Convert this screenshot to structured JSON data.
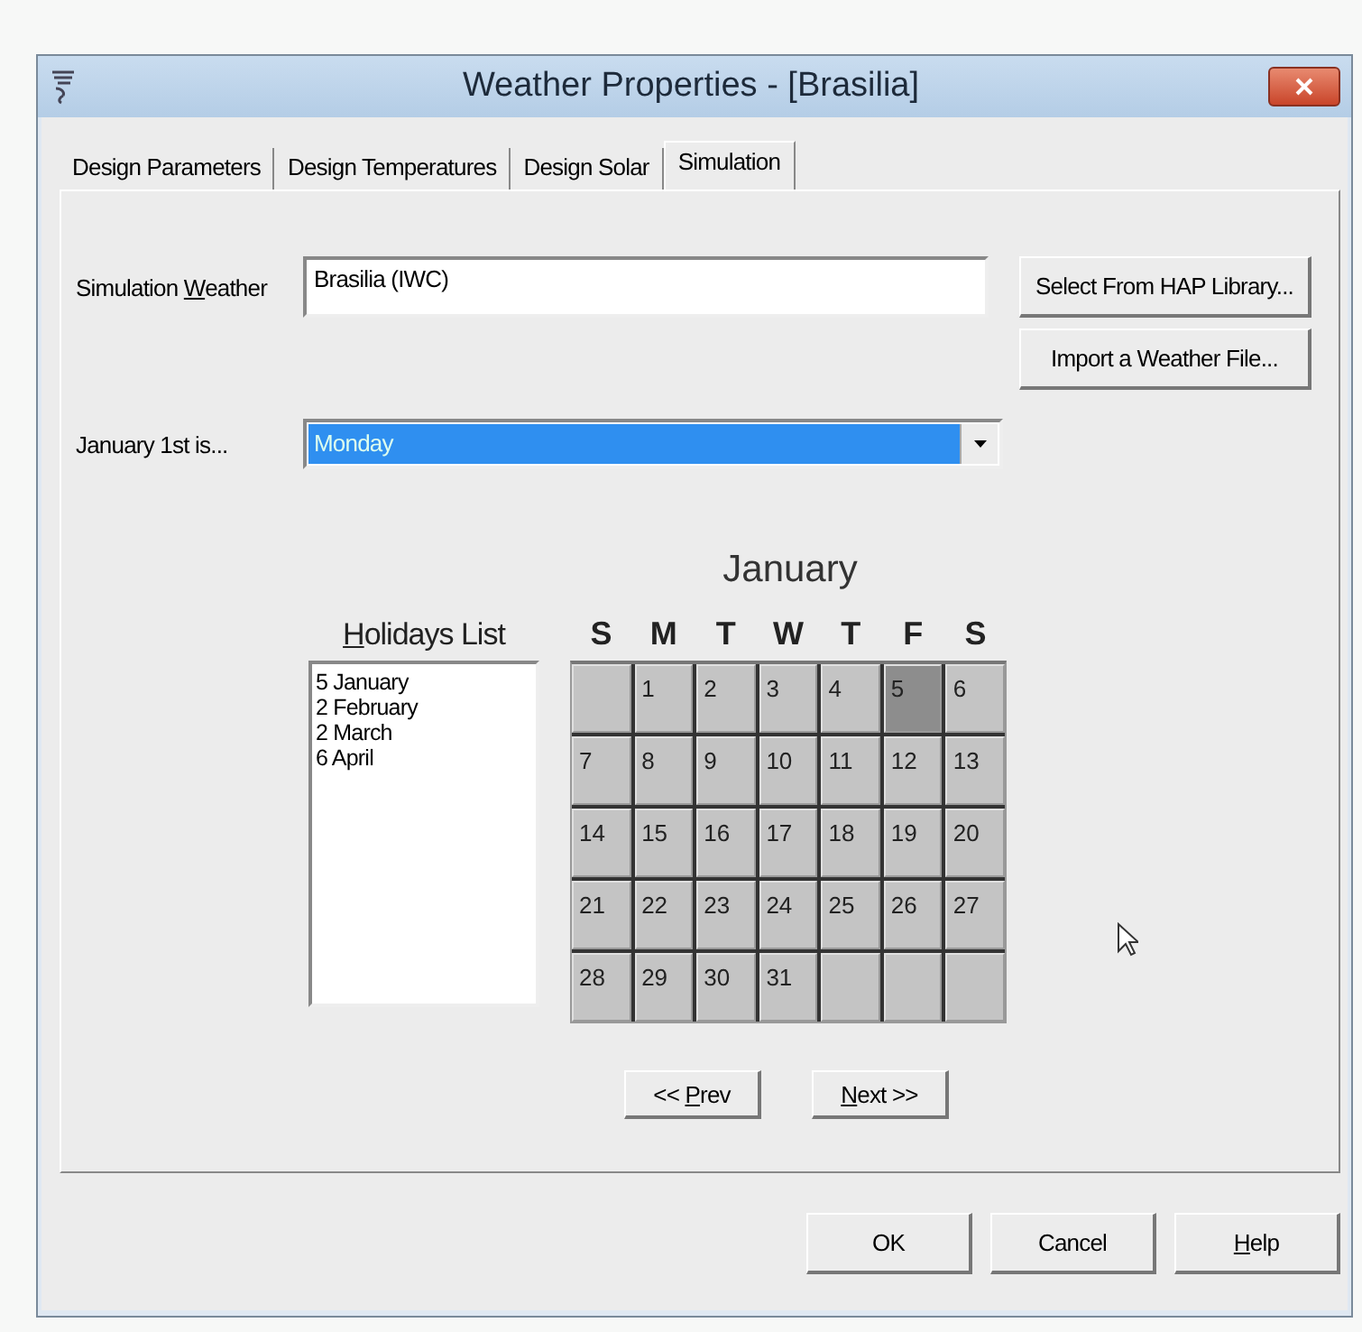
{
  "window": {
    "title": "Weather Properties - [Brasilia]"
  },
  "tabs": [
    {
      "label": "Design Parameters",
      "selected": false
    },
    {
      "label": "Design Temperatures",
      "selected": false
    },
    {
      "label": "Design Solar",
      "selected": false
    },
    {
      "label": "Simulation",
      "selected": true
    }
  ],
  "simulation_weather": {
    "label": {
      "pre": "Simulation ",
      "key": "W",
      "post": "eather"
    },
    "value": "Brasilia (IWC)"
  },
  "library_buttons": [
    "Select From HAP Library...",
    "Import a Weather File..."
  ],
  "january_first": {
    "label": "January 1st is...",
    "value": "Monday"
  },
  "holidays": {
    "label": {
      "key": "H",
      "post": "olidays List"
    },
    "items": [
      "5 January",
      "2 February",
      "2 March",
      "6 April"
    ]
  },
  "calendar": {
    "month": "January",
    "weekdays": [
      "S",
      "M",
      "T",
      "W",
      "T",
      "F",
      "S"
    ],
    "cells": [
      {
        "kind": "blank"
      },
      {
        "kind": "day",
        "day": "1",
        "holiday": false
      },
      {
        "kind": "day",
        "day": "2",
        "holiday": false
      },
      {
        "kind": "day",
        "day": "3",
        "holiday": false
      },
      {
        "kind": "day",
        "day": "4",
        "holiday": false
      },
      {
        "kind": "day",
        "day": "5",
        "holiday": true
      },
      {
        "kind": "day",
        "day": "6",
        "holiday": false
      },
      {
        "kind": "day",
        "day": "7",
        "holiday": false
      },
      {
        "kind": "day",
        "day": "8",
        "holiday": false
      },
      {
        "kind": "day",
        "day": "9",
        "holiday": false
      },
      {
        "kind": "day",
        "day": "10",
        "holiday": false
      },
      {
        "kind": "day",
        "day": "11",
        "holiday": false
      },
      {
        "kind": "day",
        "day": "12",
        "holiday": false
      },
      {
        "kind": "day",
        "day": "13",
        "holiday": false
      },
      {
        "kind": "day",
        "day": "14",
        "holiday": false
      },
      {
        "kind": "day",
        "day": "15",
        "holiday": false
      },
      {
        "kind": "day",
        "day": "16",
        "holiday": false
      },
      {
        "kind": "day",
        "day": "17",
        "holiday": false
      },
      {
        "kind": "day",
        "day": "18",
        "holiday": false
      },
      {
        "kind": "day",
        "day": "19",
        "holiday": false
      },
      {
        "kind": "day",
        "day": "20",
        "holiday": false
      },
      {
        "kind": "day",
        "day": "21",
        "holiday": false
      },
      {
        "kind": "day",
        "day": "22",
        "holiday": false
      },
      {
        "kind": "day",
        "day": "23",
        "holiday": false
      },
      {
        "kind": "day",
        "day": "24",
        "holiday": false
      },
      {
        "kind": "day",
        "day": "25",
        "holiday": false
      },
      {
        "kind": "day",
        "day": "26",
        "holiday": false
      },
      {
        "kind": "day",
        "day": "27",
        "holiday": false
      },
      {
        "kind": "day",
        "day": "28",
        "holiday": false
      },
      {
        "kind": "day",
        "day": "29",
        "holiday": false
      },
      {
        "kind": "day",
        "day": "30",
        "holiday": false
      },
      {
        "kind": "day",
        "day": "31",
        "holiday": false
      },
      {
        "kind": "blank"
      },
      {
        "kind": "blank"
      },
      {
        "kind": "blank"
      }
    ],
    "nav": [
      {
        "pre": "<< ",
        "key": "P",
        "post": "rev"
      },
      {
        "key": "N",
        "post": "ext >>"
      }
    ]
  },
  "buttons": [
    {
      "pre": "OK"
    },
    {
      "pre": "Cancel"
    },
    {
      "key": "H",
      "post": "elp"
    }
  ]
}
